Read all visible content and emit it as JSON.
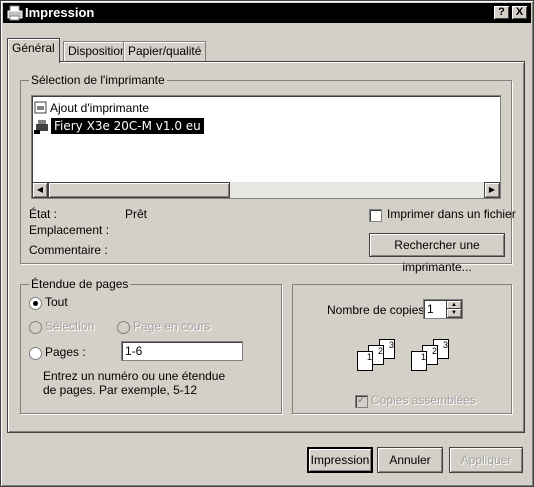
{
  "window": {
    "title": "Impression",
    "help_button": "?",
    "close_button": "X"
  },
  "tabs": [
    {
      "label": "Général"
    },
    {
      "label": "Disposition"
    },
    {
      "label": "Papier/qualité"
    }
  ],
  "printer_selection": {
    "group_label": "Sélection de l'imprimante",
    "printers": [
      {
        "name": "Ajout d'imprimante",
        "icon": "add-printer-icon"
      },
      {
        "name": "Fiery X3e 20C-M v1.0 eu",
        "icon": "printer-icon",
        "selected": true
      }
    ],
    "status_label": "État :",
    "status_value": "Prêt",
    "location_label": "Emplacement :",
    "comment_label": "Commentaire :",
    "print_to_file_label": "Imprimer dans un fichier",
    "find_printer_button": "Rechercher une imprimante..."
  },
  "page_range": {
    "group_label": "Étendue de pages",
    "all_label": "Tout",
    "selection_label": "Sélection",
    "current_page_label": "Page en cours",
    "pages_label": "Pages :",
    "pages_value": "1-6",
    "hint": "Entrez un numéro ou une étendue de pages. Par exemple, 5-12"
  },
  "copies": {
    "count_label": "Nombre de copies :",
    "count_value": "1",
    "collate_label": "Copies assemblées",
    "sheet_numbers": [
      "1",
      "2",
      "3"
    ]
  },
  "footer": {
    "print_button": "Impression",
    "cancel_button": "Annuler",
    "apply_button": "Appliquer"
  },
  "colors": {
    "selection_bg": "#000000",
    "title_bg": "#000000",
    "face": "#d4d0c8"
  }
}
